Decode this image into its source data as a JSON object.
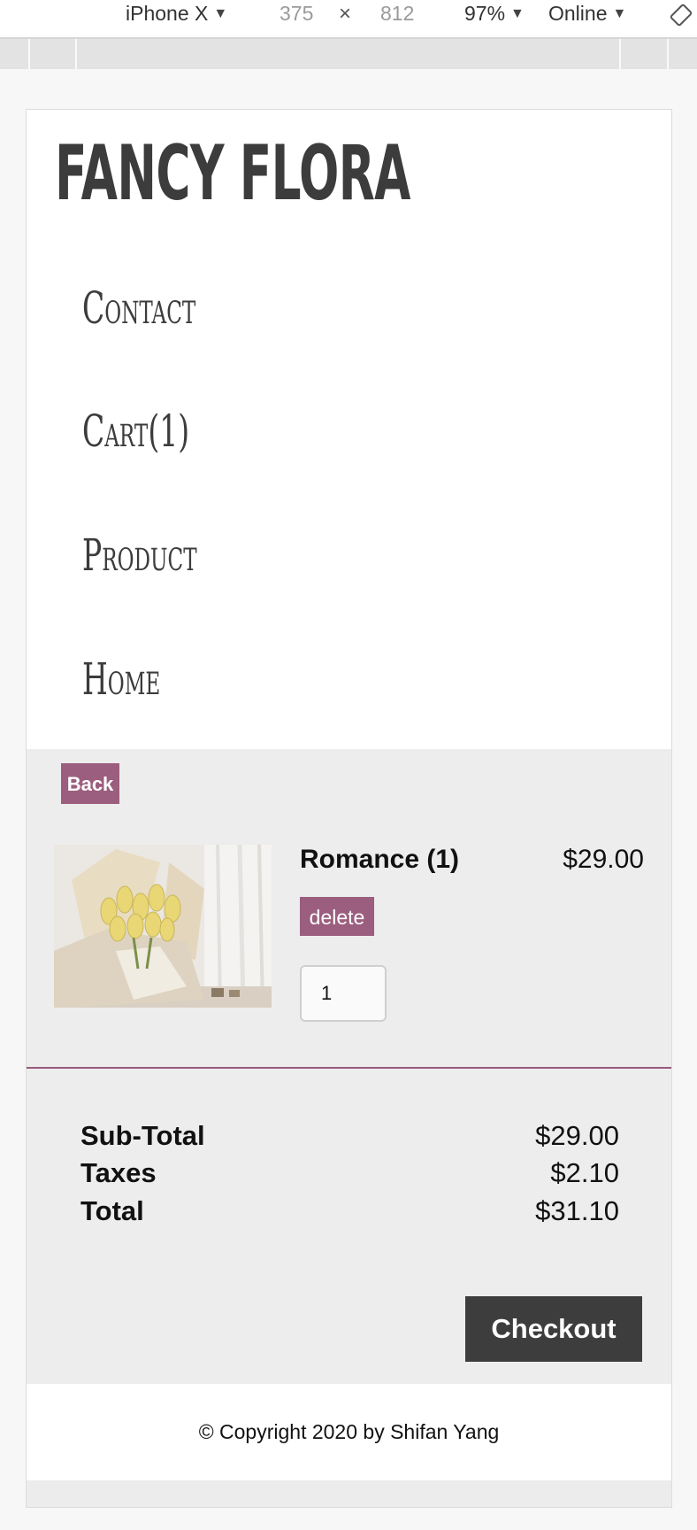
{
  "devtools": {
    "device": "iPhone X",
    "width": "375",
    "times": "×",
    "height": "812",
    "zoom": "97%",
    "network": "Online"
  },
  "site": {
    "brand": "Fancy Flora",
    "nav": [
      "Contact",
      "Cart(1)",
      "Product",
      "Home"
    ]
  },
  "cart": {
    "back_label": "Back",
    "item": {
      "name": "Romance (1)",
      "price": "$29.00",
      "delete_label": "delete",
      "quantity": "1",
      "image": "yellow-tulip-bouquet"
    }
  },
  "totals": {
    "rows": [
      {
        "label": "Sub-Total",
        "value": "$29.00"
      },
      {
        "label": "Taxes",
        "value": "$2.10"
      },
      {
        "label": "Total",
        "value": "$31.10"
      }
    ],
    "checkout_label": "Checkout"
  },
  "footer": {
    "copyright": "© Copyright 2020 by Shifan Yang"
  },
  "colors": {
    "accent": "#9b5e7e",
    "dark_button": "#3d3d3d",
    "panel": "#ededed"
  }
}
